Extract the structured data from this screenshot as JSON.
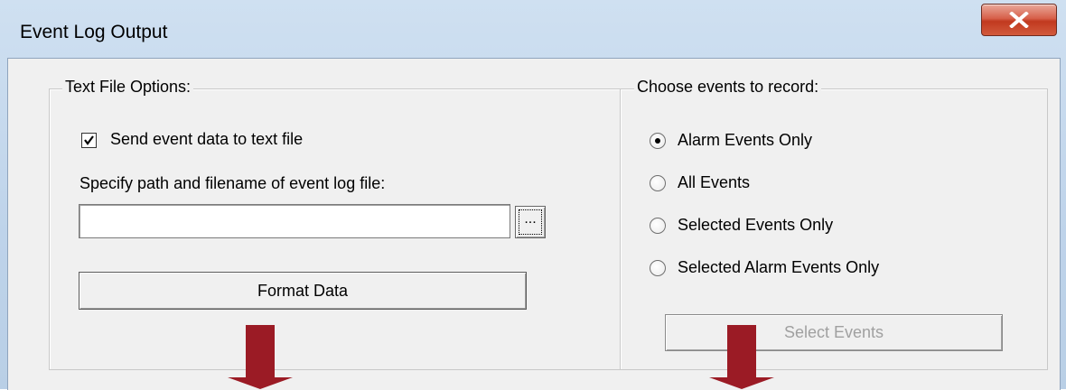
{
  "window": {
    "title": "Event Log Output",
    "close_icon": "close-icon"
  },
  "text_file_options": {
    "group_title": "Text File Options:",
    "send_checkbox": {
      "label": "Send event data to text file",
      "checked": true
    },
    "path_label": "Specify path and filename of event log file:",
    "path_input": {
      "value": "",
      "placeholder": ""
    },
    "browse_button": "...",
    "format_button": "Format Data"
  },
  "events": {
    "group_title": "Choose events to record:",
    "options": [
      {
        "label": "Alarm Events Only",
        "selected": true
      },
      {
        "label": "All Events",
        "selected": false
      },
      {
        "label": "Selected Events Only",
        "selected": false
      },
      {
        "label": "Selected Alarm Events Only",
        "selected": false
      }
    ],
    "select_button": {
      "label": "Select Events",
      "enabled": false
    }
  },
  "annotations": {
    "arrow_color": "#9b1b25",
    "arrow_icon": "down-arrow-icon"
  }
}
